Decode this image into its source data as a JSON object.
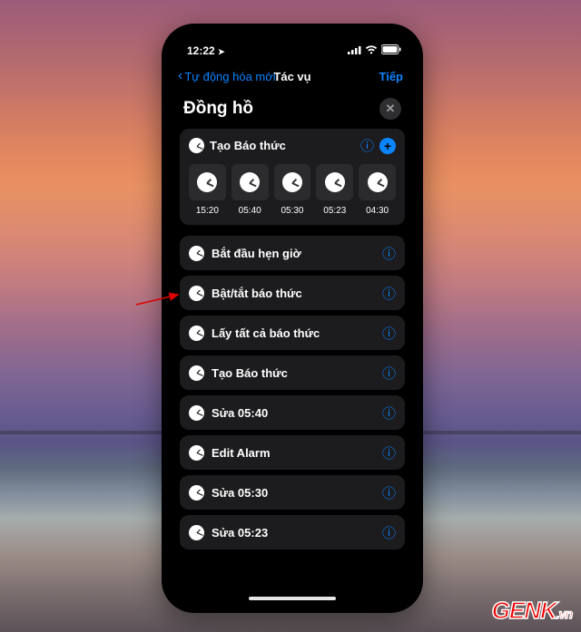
{
  "status": {
    "time": "12:22",
    "loc_glyph": "➤"
  },
  "nav": {
    "back": "Tự động hóa mới",
    "title": "Tác vụ",
    "next": "Tiếp"
  },
  "header": {
    "title": "Đồng hồ"
  },
  "card": {
    "label": "Tạo Báo thức",
    "items": [
      "15:20",
      "05:40",
      "05:30",
      "05:23",
      "04:30"
    ]
  },
  "actions": [
    {
      "label": "Bắt đầu hẹn giờ"
    },
    {
      "label": "Bật/tắt báo thức"
    },
    {
      "label": "Lấy tất cả báo thức"
    },
    {
      "label": "Tạo Báo thức"
    },
    {
      "label": "Sửa 05:40"
    },
    {
      "label": "Edit Alarm"
    },
    {
      "label": "Sửa 05:30"
    },
    {
      "label": "Sửa 05:23"
    }
  ],
  "watermark": "GENK"
}
